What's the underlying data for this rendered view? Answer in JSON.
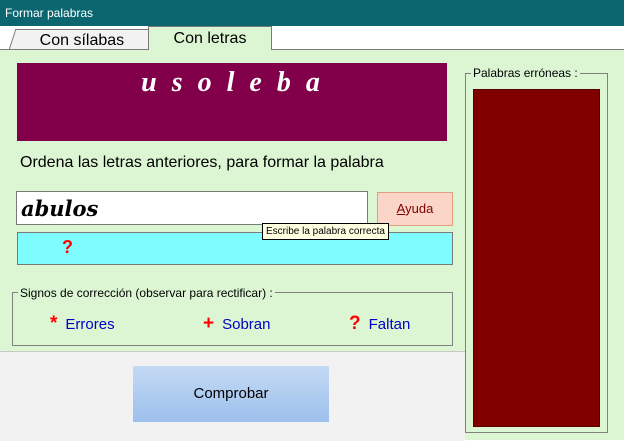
{
  "window": {
    "title": "Formar palabras"
  },
  "tabs": [
    {
      "label": "Con sílabas",
      "active": false
    },
    {
      "label": "Con letras",
      "active": true
    }
  ],
  "puzzle": {
    "scrambled": "usoleba",
    "instruction": "Ordena las letras anteriores, para formar la palabra",
    "answer_value": "abulos",
    "help_label": "Ayuda",
    "help_accesskey": "A",
    "help_rest": "yuda",
    "feedback_marker": "?",
    "tooltip": "Escribe la palabra correcta"
  },
  "signs": {
    "legend": "Signos de corrección (observar para rectificar) :",
    "items": [
      {
        "symbol": "*",
        "label": "Errores"
      },
      {
        "symbol": "+",
        "label": "Sobran"
      },
      {
        "symbol": "?",
        "label": "Faltan"
      }
    ]
  },
  "actions": {
    "check_label": "Comprobar"
  },
  "wrong_words": {
    "legend": "Palabras erróneas :",
    "items": []
  },
  "colors": {
    "titlebar": "#0b6670",
    "panel": "#dcf6d4",
    "scrambled_bg": "#82004a",
    "feedback_bg": "#7ffcff",
    "wrong_list_bg": "#800000",
    "sign_symbol": "#ff0000",
    "sign_label": "#0000c0"
  }
}
